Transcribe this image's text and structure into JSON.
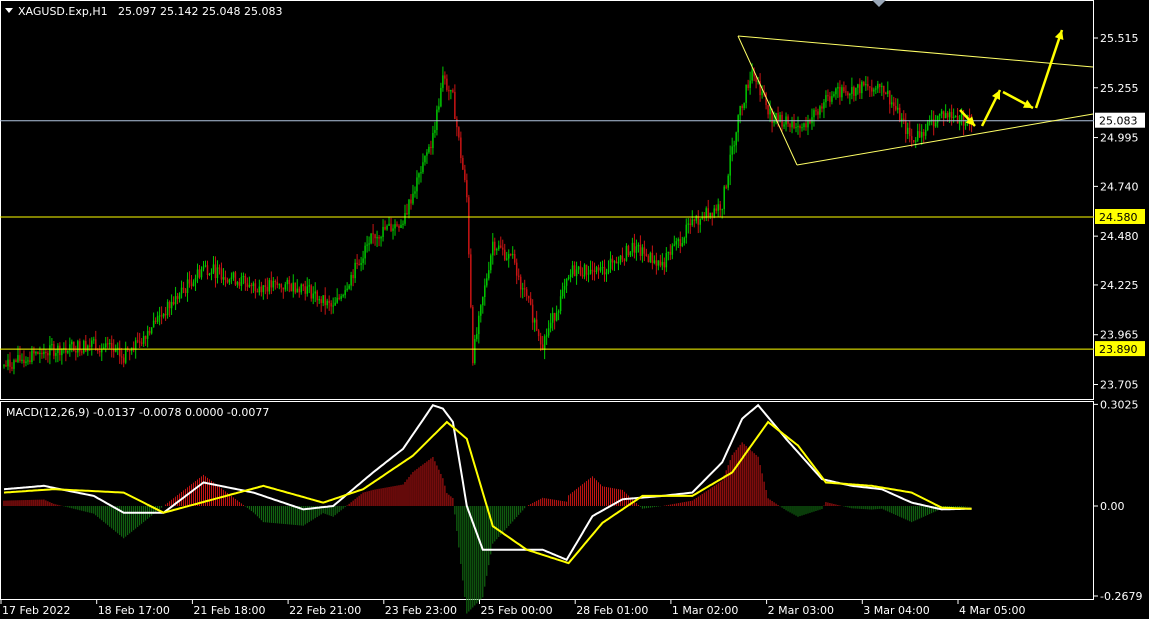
{
  "header": {
    "symbol": "XAGUSD.Exp,H1",
    "ohlc": "25.097 25.142 25.048 25.083"
  },
  "macd_header": "MACD(12,26,9) -0.0137 -0.0078 0.0000 -0.0077",
  "colors": {
    "background": "#000000",
    "bull": "#00c800",
    "bear": "#c81414",
    "level_line": "#ffff00",
    "trend_line": "#ffff66",
    "arrow": "#ffff00",
    "price_line": "#b0c4de",
    "macd_line": "#ffffff",
    "signal_line": "#ffff00",
    "hist_up": "#c81414",
    "hist_down": "#147814",
    "frame": "#ffffff"
  },
  "price_axis": {
    "ticks": [
      "25.515",
      "25.255",
      "24.995",
      "24.740",
      "24.480",
      "24.225",
      "23.965",
      "23.705"
    ],
    "current_price": "25.083",
    "levels": [
      "24.580",
      "23.890"
    ]
  },
  "macd_axis": {
    "ticks": [
      "0.3025",
      "0.00",
      "-0.2679"
    ]
  },
  "time_axis": {
    "labels": [
      "17 Feb 2022",
      "18 Feb 17:00",
      "21 Feb 18:00",
      "22 Feb 21:00",
      "23 Feb 23:00",
      "25 Feb 00:00",
      "28 Feb 01:00",
      "1 Mar 02:00",
      "2 Mar 03:00",
      "3 Mar 04:00",
      "4 Mar 05:00"
    ]
  },
  "chart_data": {
    "type": "candlestick",
    "symbol": "XAGUSD.Exp",
    "timeframe": "H1",
    "price_range": [
      23.6,
      25.65
    ],
    "price_levels": [
      24.58,
      23.89
    ],
    "last_price": 25.083,
    "anchors": [
      [
        0,
        23.8
      ],
      [
        20,
        23.88
      ],
      [
        45,
        23.92
      ],
      [
        60,
        23.85
      ],
      [
        80,
        24.08
      ],
      [
        100,
        24.32
      ],
      [
        125,
        24.22
      ],
      [
        150,
        24.22
      ],
      [
        165,
        24.1
      ],
      [
        185,
        24.48
      ],
      [
        200,
        24.56
      ],
      [
        215,
        25.0
      ],
      [
        220,
        25.3
      ],
      [
        225,
        25.2
      ],
      [
        232,
        24.68
      ],
      [
        235,
        23.85
      ],
      [
        245,
        24.45
      ],
      [
        255,
        24.35
      ],
      [
        270,
        23.92
      ],
      [
        285,
        24.3
      ],
      [
        300,
        24.3
      ],
      [
        315,
        24.42
      ],
      [
        330,
        24.33
      ],
      [
        345,
        24.55
      ],
      [
        360,
        24.65
      ],
      [
        368,
        25.1
      ],
      [
        375,
        25.35
      ],
      [
        385,
        25.1
      ],
      [
        400,
        25.05
      ],
      [
        415,
        25.22
      ],
      [
        440,
        25.28
      ],
      [
        455,
        24.98
      ],
      [
        470,
        25.12
      ],
      [
        485,
        25.08
      ]
    ],
    "macd": {
      "range": [
        -0.2679,
        0.3025
      ],
      "macd_anchors": [
        [
          0,
          0.05
        ],
        [
          20,
          0.06
        ],
        [
          45,
          0.03
        ],
        [
          60,
          -0.02
        ],
        [
          80,
          -0.02
        ],
        [
          100,
          0.07
        ],
        [
          125,
          0.04
        ],
        [
          150,
          -0.01
        ],
        [
          165,
          0.0
        ],
        [
          185,
          0.1
        ],
        [
          200,
          0.17
        ],
        [
          215,
          0.3
        ],
        [
          220,
          0.29
        ],
        [
          225,
          0.25
        ],
        [
          232,
          0.0
        ],
        [
          240,
          -0.13
        ],
        [
          255,
          -0.13
        ],
        [
          270,
          -0.13
        ],
        [
          282,
          -0.16
        ],
        [
          295,
          -0.03
        ],
        [
          310,
          0.02
        ],
        [
          330,
          0.03
        ],
        [
          345,
          0.04
        ],
        [
          360,
          0.13
        ],
        [
          370,
          0.26
        ],
        [
          378,
          0.3
        ],
        [
          392,
          0.2
        ],
        [
          410,
          0.08
        ],
        [
          425,
          0.06
        ],
        [
          440,
          0.05
        ],
        [
          455,
          0.01
        ],
        [
          470,
          -0.01
        ],
        [
          485,
          -0.008
        ]
      ],
      "signal_anchors": [
        [
          0,
          0.04
        ],
        [
          25,
          0.05
        ],
        [
          60,
          0.04
        ],
        [
          80,
          -0.02
        ],
        [
          105,
          0.02
        ],
        [
          130,
          0.06
        ],
        [
          160,
          0.01
        ],
        [
          180,
          0.05
        ],
        [
          205,
          0.15
        ],
        [
          222,
          0.25
        ],
        [
          232,
          0.2
        ],
        [
          245,
          -0.06
        ],
        [
          262,
          -0.13
        ],
        [
          283,
          -0.17
        ],
        [
          300,
          -0.05
        ],
        [
          320,
          0.03
        ],
        [
          345,
          0.03
        ],
        [
          365,
          0.1
        ],
        [
          383,
          0.25
        ],
        [
          398,
          0.18
        ],
        [
          412,
          0.07
        ],
        [
          435,
          0.06
        ],
        [
          455,
          0.04
        ],
        [
          470,
          -0.005
        ],
        [
          485,
          -0.008
        ]
      ]
    }
  }
}
